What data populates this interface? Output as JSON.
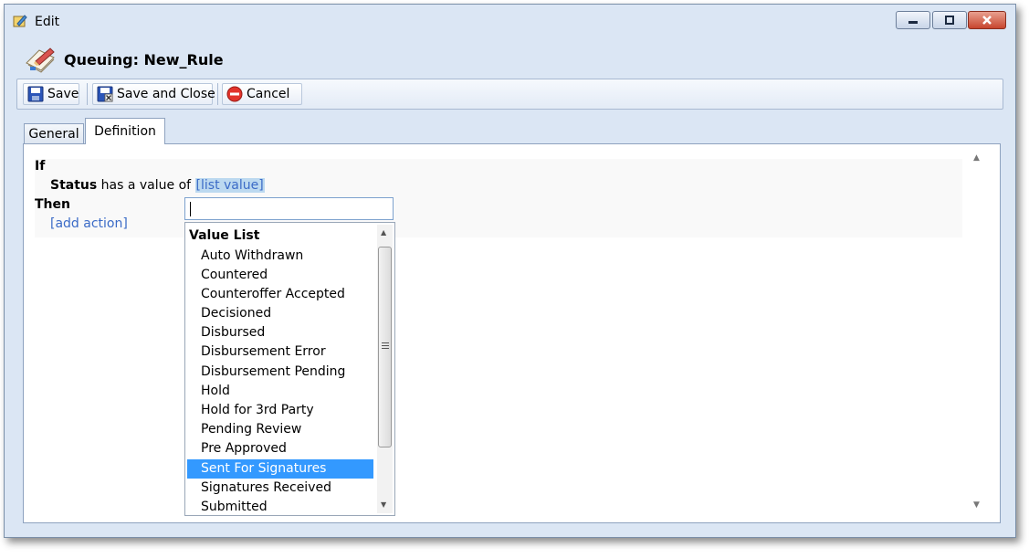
{
  "window": {
    "title": "Edit",
    "accent": "#dbe6f4"
  },
  "header": {
    "title": "Queuing: New_Rule"
  },
  "toolbar": {
    "save_label": "Save",
    "save_close_label": "Save and Close",
    "cancel_label": "Cancel"
  },
  "tabs": [
    {
      "label": "General"
    },
    {
      "label": "Definition",
      "active": true
    }
  ],
  "rule": {
    "if_label": "If",
    "field": "Status",
    "operator": "has a value of",
    "value_link": "[list value]",
    "then_label": "Then",
    "add_action": "[add action]"
  },
  "value_search": {
    "value": ""
  },
  "value_list": {
    "header": "Value List",
    "items": [
      "Auto Withdrawn",
      "Countered",
      "Counteroffer Accepted",
      "Decisioned",
      "Disbursed",
      "Disbursement Error",
      "Disbursement Pending",
      "Hold",
      "Hold for 3rd Party",
      "Pending Review",
      "Pre Approved",
      "Sent For Signatures",
      "Signatures Received",
      "Submitted"
    ],
    "selected": "Sent For Signatures"
  },
  "icons": {
    "window": "edit-pencil-icon",
    "header": "queue-rule-icon",
    "save": "floppy-disk-icon",
    "save_close": "floppy-close-icon",
    "cancel": "cancel-icon"
  },
  "colors": {
    "link": "#3b6bc7",
    "selection": "#3399ff",
    "value_highlight": "#bcd9f0"
  }
}
